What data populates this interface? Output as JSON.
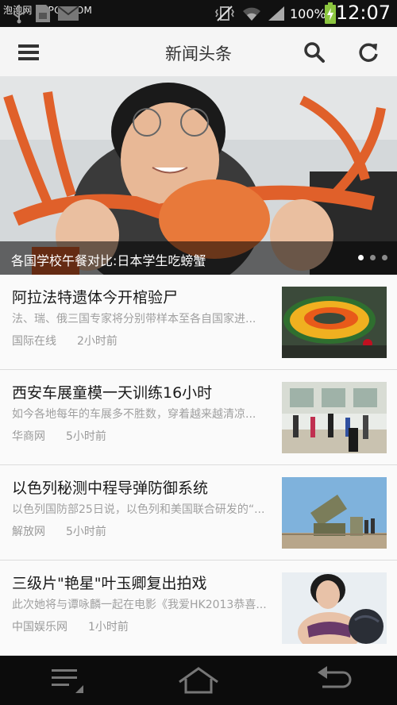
{
  "status_bar": {
    "watermark": "泡泡网 PCPOP.COM",
    "battery": "100%",
    "time": "12:07",
    "icons": [
      "usb-icon",
      "sd-card-icon",
      "mail-icon",
      "vibrate-icon",
      "wifi-icon",
      "signal-icon",
      "battery-charging-icon"
    ]
  },
  "app_bar": {
    "title": "新闻头条",
    "icons": [
      "menu-icon",
      "search-icon",
      "refresh-icon"
    ]
  },
  "hero": {
    "caption": "各国学校午餐对比:日本学生吃螃蟹",
    "slide_count": 3,
    "active_slide": 1
  },
  "news": [
    {
      "title": "阿拉法特遗体今开棺验尸",
      "summary": "法、瑞、俄三国专家将分别带样本至各自国家进...",
      "source": "国际在线",
      "time": "2小时前"
    },
    {
      "title": "西安车展童模一天训练16小时",
      "summary": "如今各地每年的车展多不胜数，穿着越来越清凉...",
      "source": "华商网",
      "time": "5小时前"
    },
    {
      "title": "以色列秘测中程导弹防御系统",
      "summary": "以色列国防部25日说，以色列和美国联合研发的“...",
      "source": "解放网",
      "time": "5小时前"
    },
    {
      "title": "三级片\"艳星\"叶玉卿复出拍戏",
      "summary": "此次她将与谭咏麟一起在电影《我爱HK2013恭喜...",
      "source": "中国娱乐网",
      "time": "1小时前"
    }
  ],
  "nav_bar": {
    "icons": [
      "recent-apps-icon",
      "home-icon",
      "back-icon"
    ]
  },
  "colors": {
    "status_bar": "#111111",
    "app_bar": "#f5f5f5",
    "caption_overlay": "#000000",
    "battery": "#8cc63f"
  }
}
